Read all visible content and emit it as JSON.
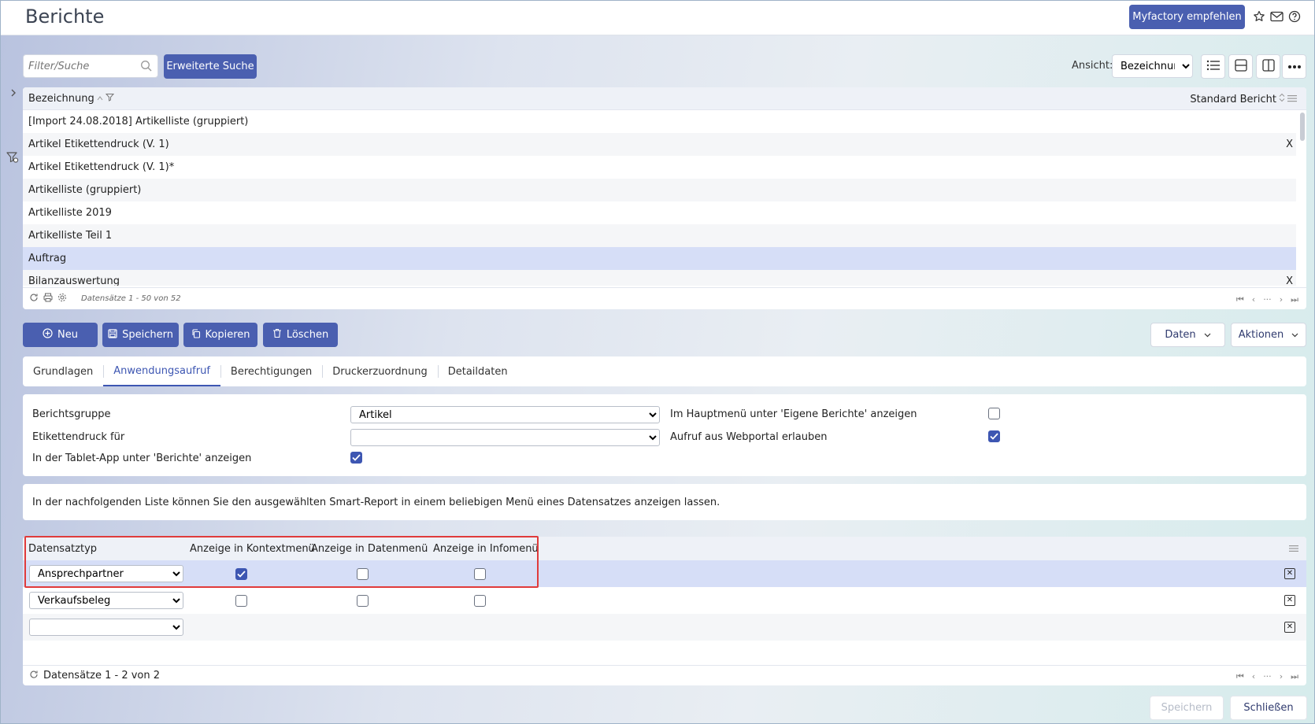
{
  "header": {
    "title": "Berichte",
    "recommend_label": "Myfactory empfehlen",
    "icons": [
      "star-icon",
      "mail-icon",
      "help-icon"
    ]
  },
  "toolbar": {
    "search_placeholder": "Filter/Suche",
    "advanced_search_label": "Erweiterte Suche",
    "view_label": "Ansicht:",
    "view_selected": "Bezeichnung"
  },
  "reports_list": {
    "columns": [
      "Bezeichnung",
      "Standard Bericht"
    ],
    "rows": [
      {
        "name": "[Import 24.08.2018] Artikelliste (gruppiert)",
        "standard": ""
      },
      {
        "name": "Artikel Etikettendruck (V. 1)",
        "standard": "X"
      },
      {
        "name": "Artikel Etikettendruck (V. 1)*",
        "standard": ""
      },
      {
        "name": "Artikelliste (gruppiert)",
        "standard": ""
      },
      {
        "name": "Artikelliste 2019",
        "standard": ""
      },
      {
        "name": "Artikelliste Teil 1",
        "standard": ""
      },
      {
        "name": "Auftrag",
        "standard": ""
      },
      {
        "name": "Bilanzauswertung",
        "standard": "X"
      }
    ],
    "selected_index": 6,
    "record_count": "Datensätze 1 - 50 von 52"
  },
  "actions": {
    "new": "Neu",
    "save": "Speichern",
    "copy": "Kopieren",
    "delete": "Löschen",
    "data": "Daten",
    "more_actions": "Aktionen"
  },
  "tabs": [
    {
      "label": "Grundlagen",
      "active": false
    },
    {
      "label": "Anwendungsaufruf",
      "active": true
    },
    {
      "label": "Berechtigungen",
      "active": false
    },
    {
      "label": "Druckerzuordnung",
      "active": false
    },
    {
      "label": "Detaildaten",
      "active": false
    }
  ],
  "form": {
    "report_group_label": "Berichtsgruppe",
    "report_group_value": "Artikel",
    "label_print_label": "Etikettendruck für",
    "label_print_value": "",
    "tablet_label": "In der Tablet-App unter 'Berichte' anzeigen",
    "tablet_checked": true,
    "main_menu_label": "Im Hauptmenü unter 'Eigene Berichte' anzeigen",
    "main_menu_checked": false,
    "webportal_label": "Aufruf aus Webportal erlauben",
    "webportal_checked": true
  },
  "info_text": "In der nachfolgenden Liste können Sie den ausgewählten Smart-Report in einem beliebigen Menü eines Datensatzes anzeigen lassen.",
  "record_grid": {
    "columns": [
      "Datensatztyp",
      "Anzeige in Kontextmenü",
      "Anzeige in Datenmenü",
      "Anzeige in Infomenü"
    ],
    "rows": [
      {
        "type": "Ansprechpartner",
        "context": true,
        "data": false,
        "info": false
      },
      {
        "type": "Verkaufsbeleg",
        "context": false,
        "data": false,
        "info": false
      },
      {
        "type": "",
        "context": false,
        "data": false,
        "info": false
      }
    ],
    "record_count": "Datensätze 1 - 2 von 2"
  },
  "bottom": {
    "save": "Speichern",
    "close": "Schließen"
  },
  "colors": {
    "primary": "#4a5fb0",
    "selected_row": "#d6def7",
    "highlight": "#e03b3b"
  }
}
